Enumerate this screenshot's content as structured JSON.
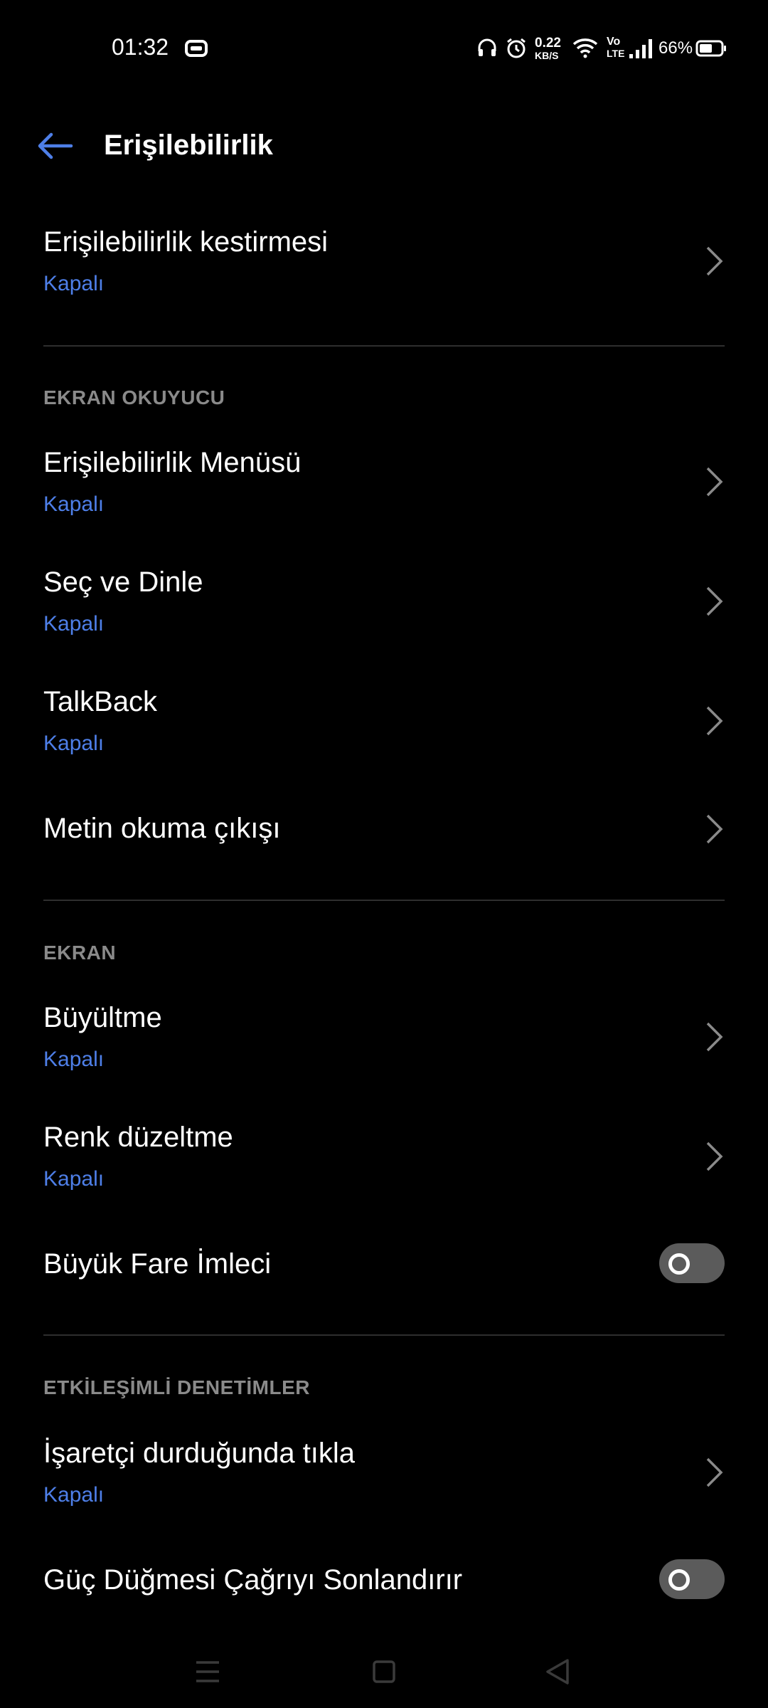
{
  "status_bar": {
    "time": "01:32",
    "net_speed_top": "0.22",
    "net_speed_bottom": "KB/S",
    "volte_top": "Vo",
    "volte_bottom": "LTE",
    "battery": "66%",
    "icons": [
      "game-controller-icon",
      "headphones-icon",
      "alarm-icon",
      "wifi-icon",
      "volte-icon",
      "signal-icon",
      "battery-icon"
    ]
  },
  "header": {
    "title": "Erişilebilirlik",
    "back_icon": "arrow-left-icon"
  },
  "colors": {
    "accent": "#4e7fe8",
    "background": "#000000",
    "section_header": "#8a8a8a",
    "divider": "#2e2e2e",
    "toggle_off": "#5b5b5b"
  },
  "rows": {
    "shortcut": {
      "title": "Erişilebilirlik kestirmesi",
      "subtitle": "Kapalı"
    },
    "menu": {
      "title": "Erişilebilirlik Menüsü",
      "subtitle": "Kapalı"
    },
    "select_to_speak": {
      "title": "Seç ve Dinle",
      "subtitle": "Kapalı"
    },
    "talkback": {
      "title": "TalkBack",
      "subtitle": "Kapalı"
    },
    "tts_output": {
      "title": "Metin okuma çıkışı"
    },
    "magnification": {
      "title": "Büyültme",
      "subtitle": "Kapalı"
    },
    "color_correction": {
      "title": "Renk düzeltme",
      "subtitle": "Kapalı"
    },
    "large_pointer": {
      "title": "Büyük Fare İmleci",
      "toggle_on": false
    },
    "dwell_click": {
      "title": "İşaretçi durduğunda tıkla",
      "subtitle": "Kapalı"
    },
    "power_ends_call": {
      "title": "Güç Düğmesi Çağrıyı Sonlandırır",
      "toggle_on": false
    }
  },
  "sections": {
    "screen_reader": "EKRAN OKUYUCU",
    "display": "EKRAN",
    "interaction": "ETKİLEŞİMLİ DENETİMLER"
  },
  "nav_bar": {
    "icons": [
      "menu-icon",
      "home-icon",
      "back-triangle-icon"
    ]
  }
}
